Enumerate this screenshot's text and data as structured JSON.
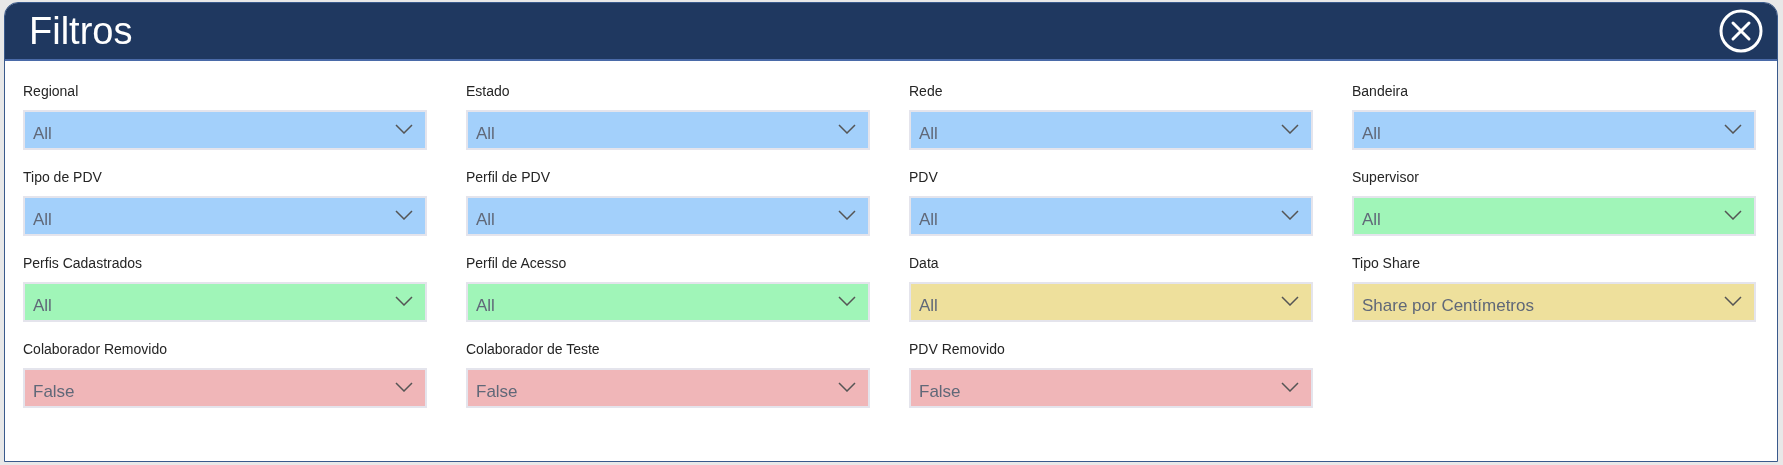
{
  "dialog": {
    "title": "Filtros"
  },
  "filters": [
    {
      "label": "Regional",
      "value": "All",
      "color": "#a3d0fb"
    },
    {
      "label": "Estado",
      "value": "All",
      "color": "#a3d0fb"
    },
    {
      "label": "Rede",
      "value": "All",
      "color": "#a3d0fb"
    },
    {
      "label": "Bandeira",
      "value": "All",
      "color": "#a3d0fb"
    },
    {
      "label": "Tipo de PDV",
      "value": "All",
      "color": "#a3d0fb"
    },
    {
      "label": "Perfil de PDV",
      "value": "All",
      "color": "#a3d0fb"
    },
    {
      "label": "PDV",
      "value": "All",
      "color": "#a3d0fb"
    },
    {
      "label": "Supervisor",
      "value": "All",
      "color": "#a0f5b8"
    },
    {
      "label": "Perfis Cadastrados",
      "value": "All",
      "color": "#a0f5b8"
    },
    {
      "label": "Perfil de Acesso",
      "value": "All",
      "color": "#a0f5b8"
    },
    {
      "label": "Data",
      "value": "All",
      "color": "#eee09c"
    },
    {
      "label": "Tipo Share",
      "value": "Share por Centímetros",
      "color": "#eee09c"
    },
    {
      "label": "Colaborador Removido",
      "value": "False",
      "color": "#f0b6b8"
    },
    {
      "label": "Colaborador de Teste",
      "value": "False",
      "color": "#f0b6b8"
    },
    {
      "label": "PDV Removido",
      "value": "False",
      "color": "#f0b6b8"
    }
  ]
}
